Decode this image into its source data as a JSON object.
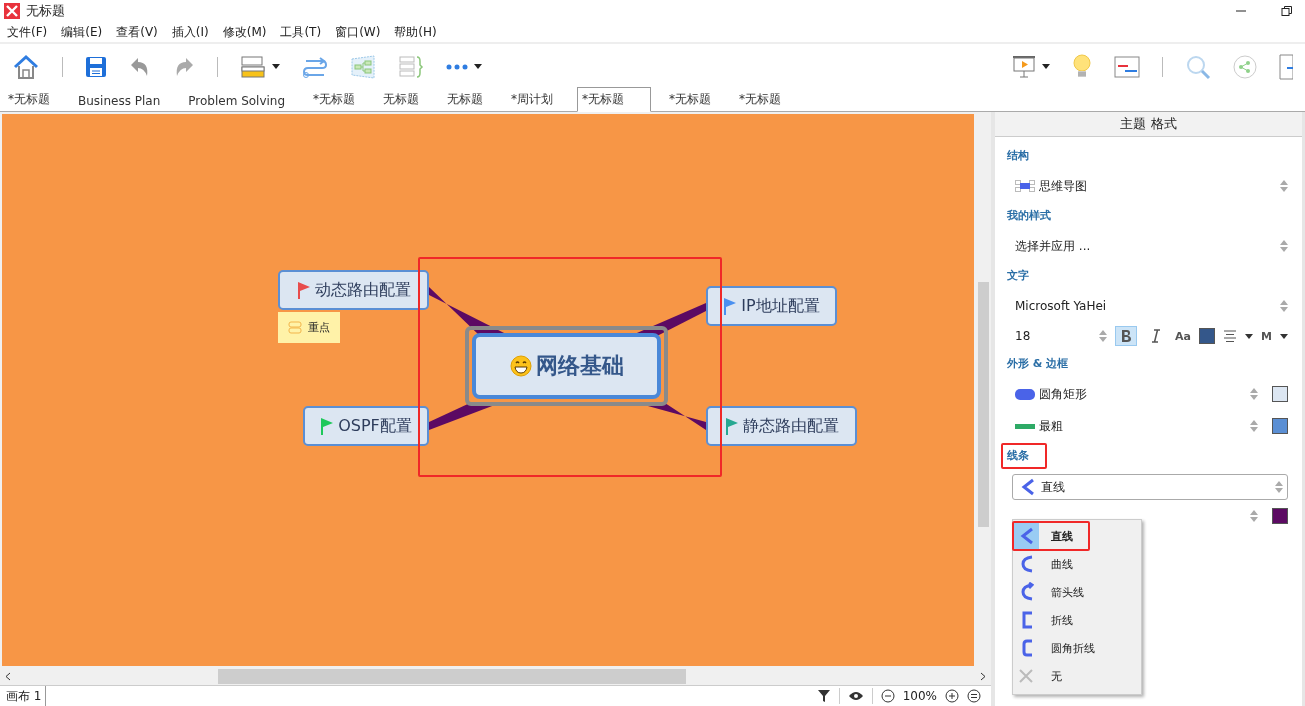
{
  "window": {
    "title": "无标题"
  },
  "menu": [
    "文件(F)",
    "编辑(E)",
    "查看(V)",
    "插入(I)",
    "修改(M)",
    "工具(T)",
    "窗口(W)",
    "帮助(H)"
  ],
  "tabs": [
    {
      "label": "*无标题",
      "selected": false
    },
    {
      "label": "Business Plan",
      "selected": false
    },
    {
      "label": "Problem Solving",
      "selected": false
    },
    {
      "label": "*无标题",
      "selected": false
    },
    {
      "label": "无标题",
      "selected": false
    },
    {
      "label": "无标题",
      "selected": false
    },
    {
      "label": "*周计划",
      "selected": false
    },
    {
      "label": "*无标题",
      "selected": true
    },
    {
      "label": "*无标题",
      "selected": false
    },
    {
      "label": "*无标题",
      "selected": false
    }
  ],
  "mindmap": {
    "central": {
      "text": "网络基础"
    },
    "topics": [
      {
        "text": "动态路由配置",
        "color": "#e84c4c",
        "label": "重点"
      },
      {
        "text": "IP地址配置",
        "color": "#4a90f0"
      },
      {
        "text": "OSPF配置",
        "color": "#1ec85a"
      },
      {
        "text": "静态路由配置",
        "color": "#26a892"
      }
    ]
  },
  "format_panel": {
    "title": "主题 格式",
    "structure": {
      "heading": "结构",
      "value": "思维导图"
    },
    "my_style": {
      "heading": "我的样式",
      "value": "选择并应用 ..."
    },
    "text": {
      "heading": "文字",
      "font": "Microsoft YaHei",
      "size": "18",
      "bold": true,
      "italic": false,
      "case_label": "Aa",
      "color": "#34578a",
      "weight_label": "M"
    },
    "shape": {
      "heading": "外形 & 边框",
      "rows": [
        {
          "kind": "shape",
          "label": "圆角矩形",
          "color": "#dce6f2"
        },
        {
          "kind": "border",
          "label": "最粗",
          "color": "#5b8fd4"
        }
      ]
    },
    "line": {
      "heading": "线条",
      "value": "直线",
      "color": "#5c0a63",
      "options": [
        {
          "label": "直线",
          "kind": "straight",
          "selected": true
        },
        {
          "label": "曲线",
          "kind": "curve",
          "selected": false
        },
        {
          "label": "箭头线",
          "kind": "arrow",
          "selected": false
        },
        {
          "label": "折线",
          "kind": "elbow",
          "selected": false
        },
        {
          "label": "圆角折线",
          "kind": "rounded",
          "selected": false
        },
        {
          "label": "无",
          "kind": "none",
          "selected": false
        }
      ]
    }
  },
  "status_bar": {
    "sheet": "画布 1",
    "zoom": "100%"
  }
}
